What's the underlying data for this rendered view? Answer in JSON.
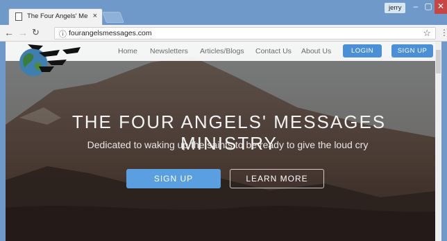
{
  "browser": {
    "tab_title": "The Four Angels' Messag",
    "tab_close": "×",
    "user_badge": "jerry",
    "url": "fourangelsmessages.com"
  },
  "site": {
    "nav": {
      "home": "Home",
      "newsletters": "Newsletters",
      "articles": "Articles/Blogs",
      "contact": "Contact Us",
      "about": "About Us",
      "login": "LOGIN",
      "signup": "SIGN UP"
    },
    "hero": {
      "title": "THE FOUR ANGELS' MESSAGES MINISTRY",
      "subtitle": "Dedicated to waking up the saints to be ready to give the loud cry",
      "signup_button": "SIGN UP",
      "learn_more_button": "LEARN MORE"
    }
  },
  "colors": {
    "accent": "#4b8fd6",
    "window_frame": "#6e99c9",
    "close_button": "#c64545"
  }
}
